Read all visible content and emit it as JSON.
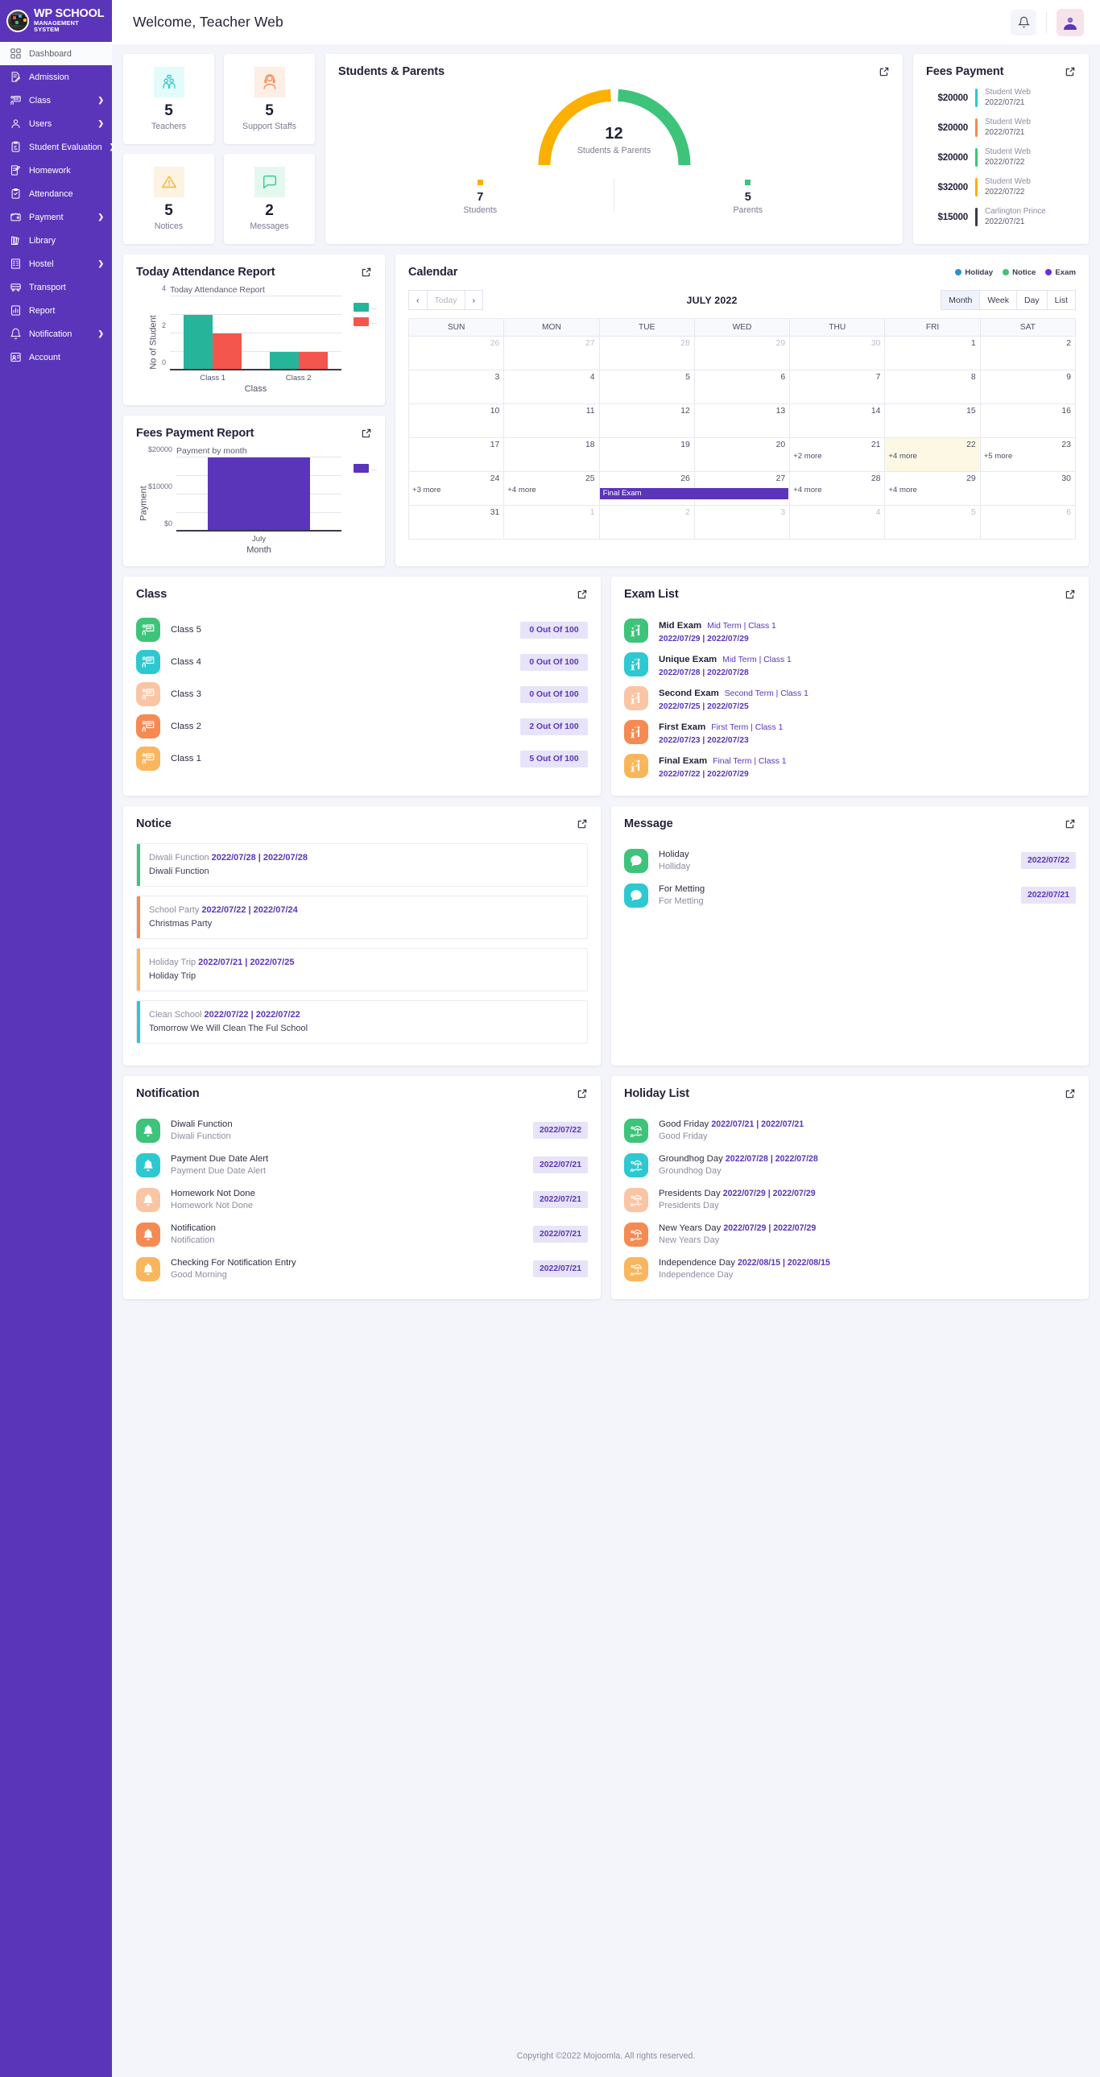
{
  "brand": {
    "title": "WP SCHOOL",
    "subtitle": "MANAGEMENT SYSTEM",
    "logo_icon": "graduation-cap-logo"
  },
  "sidebar": {
    "items": [
      {
        "label": "Dashboard",
        "icon": "grid-icon",
        "chevron": "",
        "active": true
      },
      {
        "label": "Admission",
        "icon": "document-edit-icon",
        "chevron": "",
        "active": false
      },
      {
        "label": "Class",
        "icon": "classroom-icon",
        "chevron": "❯",
        "active": false
      },
      {
        "label": "Users",
        "icon": "user-icon",
        "chevron": "❯",
        "active": false
      },
      {
        "label": "Student Evaluation",
        "icon": "clipboard-check-icon",
        "chevron": "❯",
        "active": false
      },
      {
        "label": "Homework",
        "icon": "book-pencil-icon",
        "chevron": "",
        "active": false
      },
      {
        "label": "Attendance",
        "icon": "clipboard-tick-icon",
        "chevron": "",
        "active": false
      },
      {
        "label": "Payment",
        "icon": "wallet-icon",
        "chevron": "❯",
        "active": false
      },
      {
        "label": "Library",
        "icon": "books-icon",
        "chevron": "",
        "active": false
      },
      {
        "label": "Hostel",
        "icon": "building-icon",
        "chevron": "❯",
        "active": false
      },
      {
        "label": "Transport",
        "icon": "bus-icon",
        "chevron": "",
        "active": false
      },
      {
        "label": "Report",
        "icon": "report-icon",
        "chevron": "",
        "active": false
      },
      {
        "label": "Notification",
        "icon": "bell-icon",
        "chevron": "❯",
        "active": false
      },
      {
        "label": "Account",
        "icon": "account-icon",
        "chevron": "",
        "active": false
      }
    ]
  },
  "topbar": {
    "welcome": "Welcome, Teacher Web",
    "bell_icon": "notification-bell-icon",
    "avatar_icon": "user-avatar-icon"
  },
  "stats": [
    {
      "value": "5",
      "label": "Teachers",
      "icon": "family-group-icon",
      "bg": "#e4fbfb",
      "color": "#2ec8c8"
    },
    {
      "value": "5",
      "label": "Support Staffs",
      "icon": "headset-agent-icon",
      "bg": "#fdeee6",
      "color": "#f58a52"
    },
    {
      "value": "5",
      "label": "Notices",
      "icon": "warning-icon",
      "bg": "#fdf3e2",
      "color": "#f5b942"
    },
    {
      "value": "2",
      "label": "Messages",
      "icon": "chat-icon",
      "bg": "#e5f8f0",
      "color": "#3ec69a"
    }
  ],
  "students_parents": {
    "title": "Students & Parents",
    "expand_icon": "external-link-icon",
    "total": "12",
    "total_caption": "Students & Parents",
    "legend": [
      {
        "value": "7",
        "label": "Students",
        "color": "#fcb001"
      },
      {
        "value": "5",
        "label": "Parents",
        "color": "#3ec47a"
      }
    ]
  },
  "fees_payment": {
    "title": "Fees Payment",
    "expand_icon": "external-link-icon",
    "rows": [
      {
        "amount": "$20000",
        "name": "Student Web",
        "date": "2022/07/21",
        "color": "#2ec8d0"
      },
      {
        "amount": "$20000",
        "name": "Student Web",
        "date": "2022/07/21",
        "color": "#f58a52"
      },
      {
        "amount": "$20000",
        "name": "Student Web",
        "date": "2022/07/22",
        "color": "#3ec47a"
      },
      {
        "amount": "$32000",
        "name": "Student Web",
        "date": "2022/07/22",
        "color": "#fcb001"
      },
      {
        "amount": "$15000",
        "name": "Carlington Prince",
        "date": "2022/07/21",
        "color": "#3a3a44"
      }
    ]
  },
  "chart_data": [
    {
      "type": "bar",
      "card_title": "Today Attendance Report",
      "expand_icon": "external-link-icon",
      "title": "Today Attendance Report",
      "xlabel": "Class",
      "ylabel": "No of Student",
      "categories": [
        "Class 1",
        "Class 2"
      ],
      "ylim": [
        0,
        4
      ],
      "yticks": [
        "0",
        "2",
        "4"
      ],
      "grid": true,
      "legend_position": "right",
      "series": [
        {
          "name": "...",
          "values": [
            3,
            1
          ],
          "color": "#26b49a"
        },
        {
          "name": "...",
          "values": [
            2,
            1
          ],
          "color": "#f4564e"
        }
      ]
    },
    {
      "type": "bar",
      "card_title": "Fees Payment Report",
      "expand_icon": "external-link-icon",
      "title": "Payment by month",
      "xlabel": "Month",
      "ylabel": "Payment",
      "categories": [
        "July"
      ],
      "ylim": [
        0,
        20000
      ],
      "yticks": [
        "$0",
        "$10000",
        "$20000"
      ],
      "grid": true,
      "legend_position": "right",
      "series": [
        {
          "name": "...",
          "values": [
            20000
          ],
          "color": "#5a35ba"
        }
      ]
    }
  ],
  "calendar": {
    "title": "Calendar",
    "legend": [
      {
        "label": "Holiday",
        "color": "#2f8fd0"
      },
      {
        "label": "Notice",
        "color": "#3ec47a"
      },
      {
        "label": "Exam",
        "color": "#6b2fd6"
      }
    ],
    "prev_label": "‹",
    "today_label": "Today",
    "next_label": "›",
    "period": "JULY 2022",
    "views": [
      {
        "label": "Month",
        "selected": true
      },
      {
        "label": "Week",
        "selected": false
      },
      {
        "label": "Day",
        "selected": false
      },
      {
        "label": "List",
        "selected": false
      }
    ],
    "day_headers": [
      "SUN",
      "MON",
      "TUE",
      "WED",
      "THU",
      "FRI",
      "SAT"
    ],
    "weeks": [
      [
        {
          "day": "26",
          "other": true
        },
        {
          "day": "27",
          "other": true
        },
        {
          "day": "28",
          "other": true
        },
        {
          "day": "29",
          "other": true
        },
        {
          "day": "30",
          "other": true
        },
        {
          "day": "1"
        },
        {
          "day": "2"
        }
      ],
      [
        {
          "day": "3"
        },
        {
          "day": "4"
        },
        {
          "day": "5"
        },
        {
          "day": "6"
        },
        {
          "day": "7"
        },
        {
          "day": "8"
        },
        {
          "day": "9"
        }
      ],
      [
        {
          "day": "10"
        },
        {
          "day": "11"
        },
        {
          "day": "12"
        },
        {
          "day": "13"
        },
        {
          "day": "14"
        },
        {
          "day": "15"
        },
        {
          "day": "16"
        }
      ],
      [
        {
          "day": "17"
        },
        {
          "day": "18"
        },
        {
          "day": "19"
        },
        {
          "day": "20"
        },
        {
          "day": "21",
          "more": "+2 more"
        },
        {
          "day": "22",
          "more": "+4 more",
          "today": true
        },
        {
          "day": "23",
          "more": "+5 more"
        }
      ],
      [
        {
          "day": "24",
          "more": "+3 more"
        },
        {
          "day": "25",
          "more": "+4 more"
        },
        {
          "day": "26",
          "event": "Final Exam",
          "event_span": 2,
          "event_color": "#5a35ba"
        },
        {
          "day": "27"
        },
        {
          "day": "28",
          "more": "+4 more"
        },
        {
          "day": "29",
          "more": "+4 more"
        },
        {
          "day": "30"
        }
      ],
      [
        {
          "day": "31"
        },
        {
          "day": "1",
          "other": true
        },
        {
          "day": "2",
          "other": true
        },
        {
          "day": "3",
          "other": true
        },
        {
          "day": "4",
          "other": true
        },
        {
          "day": "5",
          "other": true
        },
        {
          "day": "6",
          "other": true
        }
      ]
    ]
  },
  "class_card": {
    "title": "Class",
    "expand_icon": "external-link-icon",
    "rows": [
      {
        "name": "Class 5",
        "badge": "0 Out Of 100",
        "color": "#3ec47a",
        "icon": "classroom-icon"
      },
      {
        "name": "Class 4",
        "badge": "0 Out Of 100",
        "color": "#2ec8d0",
        "icon": "classroom-icon"
      },
      {
        "name": "Class 3",
        "badge": "0 Out Of 100",
        "color": "#fac5a4",
        "icon": "classroom-icon"
      },
      {
        "name": "Class 2",
        "badge": "2 Out Of 100",
        "color": "#f58a52",
        "icon": "classroom-icon"
      },
      {
        "name": "Class 1",
        "badge": "5 Out Of 100",
        "color": "#f9b65c",
        "icon": "classroom-icon"
      }
    ]
  },
  "exam_list": {
    "title": "Exam List",
    "expand_icon": "external-link-icon",
    "rows": [
      {
        "name": "Mid Exam",
        "meta": "Mid Term | Class 1",
        "dates": "2022/07/29 | 2022/07/29",
        "color": "#3ec47a",
        "icon": "teacher-student-icon"
      },
      {
        "name": "Unique Exam",
        "meta": "Mid Term | Class 1",
        "dates": "2022/07/28 | 2022/07/28",
        "color": "#2ec8d0",
        "icon": "teacher-student-icon"
      },
      {
        "name": "Second Exam",
        "meta": "Second Term | Class 1",
        "dates": "2022/07/25 | 2022/07/25",
        "color": "#fac5a4",
        "icon": "teacher-student-icon"
      },
      {
        "name": "First Exam",
        "meta": "First Term | Class 1",
        "dates": "2022/07/23 | 2022/07/23",
        "color": "#f58a52",
        "icon": "teacher-student-icon"
      },
      {
        "name": "Final Exam",
        "meta": "Final Term | Class 1",
        "dates": "2022/07/22 | 2022/07/29",
        "color": "#f9b65c",
        "icon": "teacher-student-icon"
      }
    ]
  },
  "notice": {
    "title": "Notice",
    "expand_icon": "external-link-icon",
    "rows": [
      {
        "name": "Diwali Function",
        "dates": "2022/07/28  |  2022/07/28",
        "desc": "Diwali Function",
        "color": "#3ec47a"
      },
      {
        "name": "School Party",
        "dates": "2022/07/22  |  2022/07/24",
        "desc": "Christmas Party",
        "color": "#f58a52"
      },
      {
        "name": "Holiday Trip",
        "dates": "2022/07/21  |  2022/07/25",
        "desc": "Holiday Trip",
        "color": "#f9b65c"
      },
      {
        "name": "Clean School",
        "dates": "2022/07/22  |  2022/07/22",
        "desc": "Tomorrow We Will Clean The Ful School",
        "color": "#2ec8d0"
      }
    ]
  },
  "message": {
    "title": "Message",
    "expand_icon": "external-link-icon",
    "rows": [
      {
        "title": "Holiday",
        "sub": "Holliday",
        "date": "2022/07/22",
        "color": "#3ec47a",
        "icon": "chat-bubble-icon"
      },
      {
        "title": "For Metting",
        "sub": "For Metting",
        "date": "2022/07/21",
        "color": "#2ec8d0",
        "icon": "chat-bubble-icon"
      }
    ]
  },
  "notification": {
    "title": "Notification",
    "expand_icon": "external-link-icon",
    "rows": [
      {
        "title": "Diwali Function",
        "sub": "Diwali Function",
        "date": "2022/07/22",
        "color": "#3ec47a",
        "icon": "bell-icon"
      },
      {
        "title": "Payment Due Date Alert",
        "sub": "Payment Due Date Alert",
        "date": "2022/07/21",
        "color": "#2ec8d0",
        "icon": "bell-icon"
      },
      {
        "title": "Homework Not Done",
        "sub": "Homework Not Done",
        "date": "2022/07/21",
        "color": "#fac5a4",
        "icon": "bell-icon"
      },
      {
        "title": "Notification",
        "sub": "Notification",
        "date": "2022/07/21",
        "color": "#f58a52",
        "icon": "bell-icon"
      },
      {
        "title": "Checking For Notification Entry",
        "sub": "Good Morning",
        "date": "2022/07/21",
        "color": "#f9b65c",
        "icon": "bell-icon"
      }
    ]
  },
  "holiday_list": {
    "title": "Holiday List",
    "expand_icon": "external-link-icon",
    "rows": [
      {
        "name": "Good Friday",
        "dates": "2022/07/21 | 2022/07/21",
        "desc": "Good Friday",
        "color": "#3ec47a",
        "icon": "beach-icon"
      },
      {
        "name": "Groundhog Day",
        "dates": "2022/07/28 | 2022/07/28",
        "desc": "Groundhog Day",
        "color": "#2ec8d0",
        "icon": "beach-icon"
      },
      {
        "name": "Presidents Day",
        "dates": "2022/07/29 | 2022/07/29",
        "desc": "Presidents Day",
        "color": "#fac5a4",
        "icon": "beach-icon"
      },
      {
        "name": "New Years Day",
        "dates": "2022/07/29 | 2022/07/29",
        "desc": "New Years Day",
        "color": "#f58a52",
        "icon": "beach-icon"
      },
      {
        "name": "Independence Day",
        "dates": "2022/08/15 | 2022/08/15",
        "desc": "Independence Day",
        "color": "#f9b65c",
        "icon": "beach-icon"
      }
    ]
  },
  "footer": {
    "text": "Copyright ©2022 Mojoomla. All rights reserved."
  }
}
